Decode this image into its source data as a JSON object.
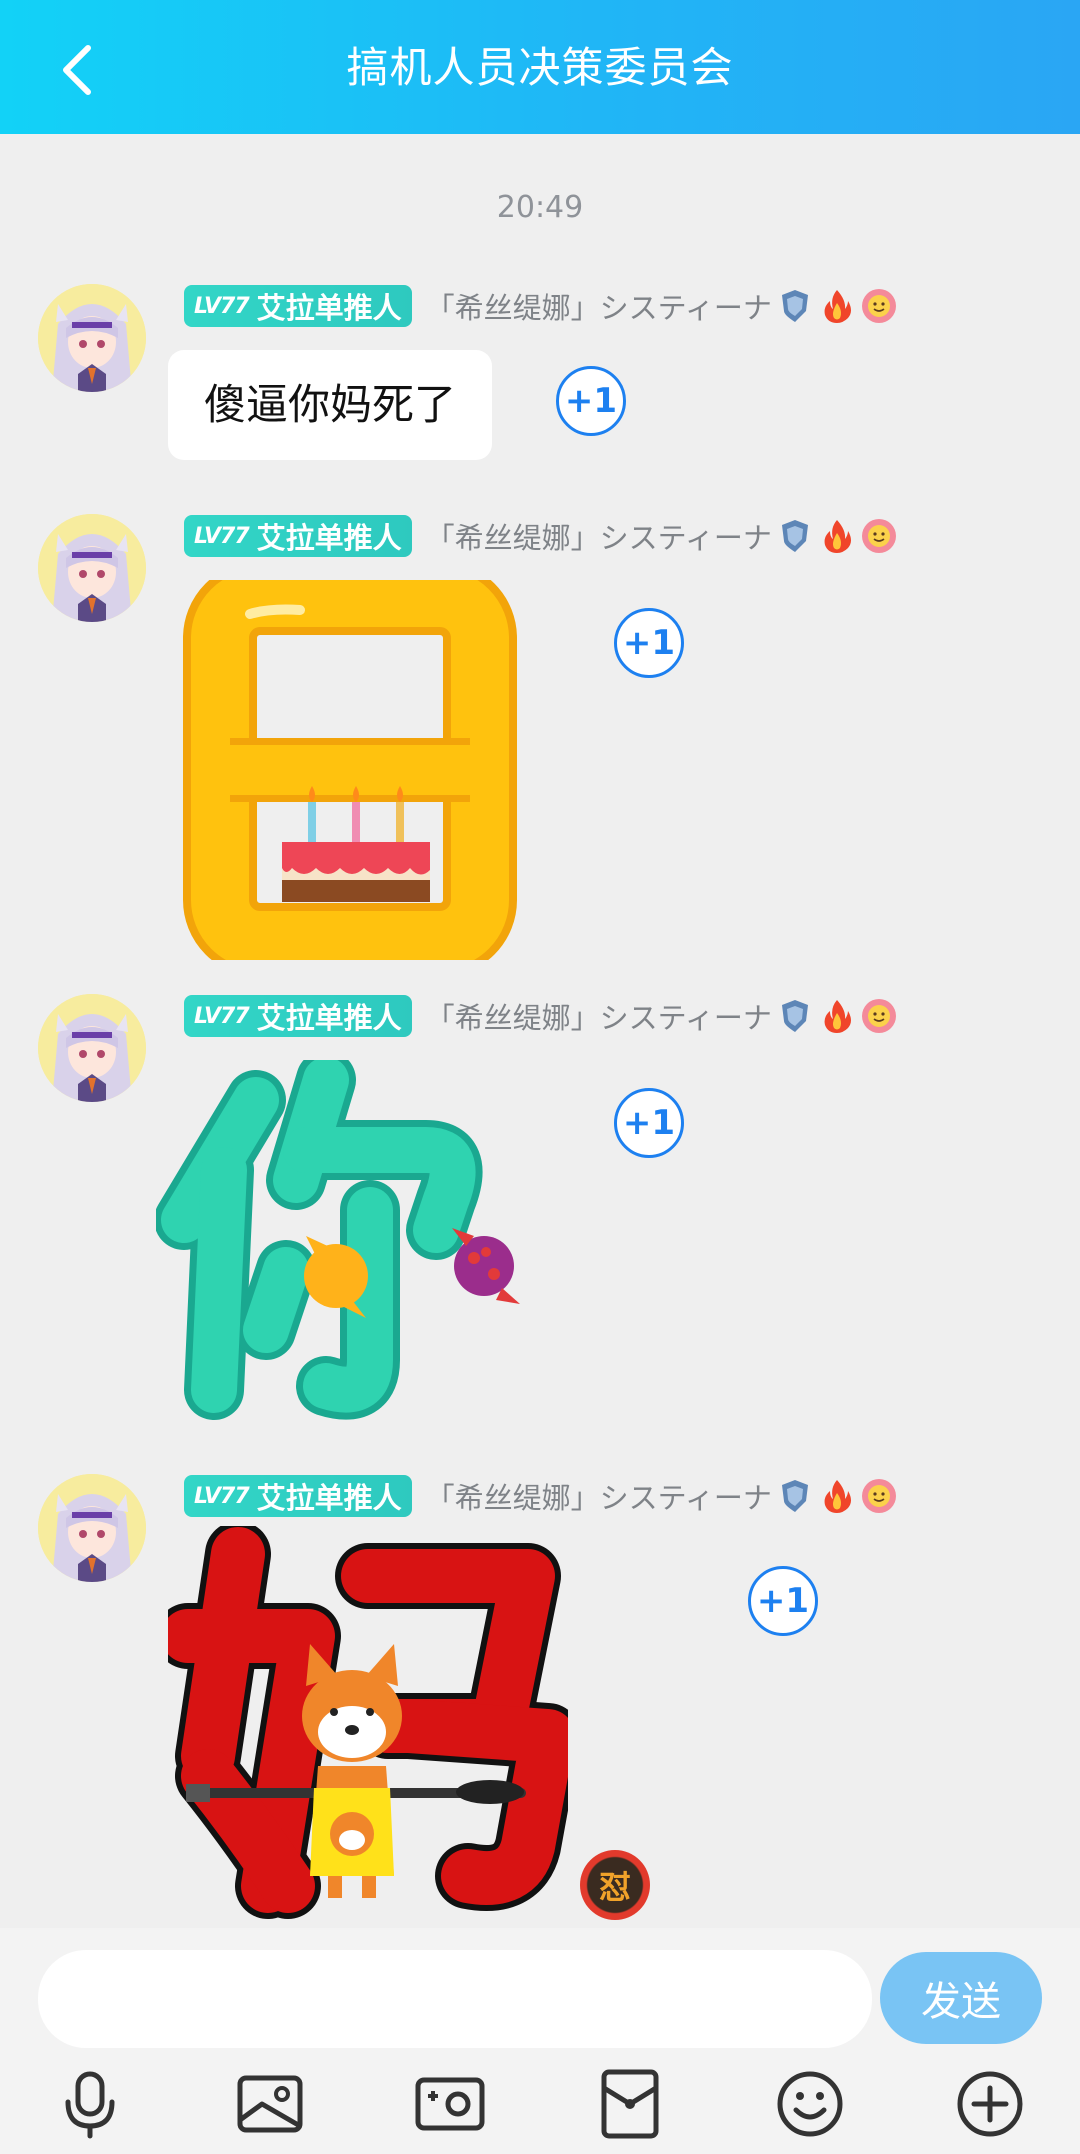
{
  "header": {
    "title": "搞机人员决策委员会"
  },
  "timestamp": "20:49",
  "sender": {
    "level": "LV77",
    "role": "艾拉单推人",
    "name": "「希丝缇娜」システィーナ"
  },
  "messages": [
    {
      "text": "傻逼你妈死了",
      "plus_one": "+1"
    },
    {
      "sticker_text": "日",
      "plus_one": "+1"
    },
    {
      "sticker_text": "你",
      "plus_one": "+1"
    },
    {
      "sticker_text": "妈",
      "plus_one": "+1",
      "reaction": "怼"
    }
  ],
  "input": {
    "value": "",
    "send_label": "发送"
  },
  "toolbar": [
    "microphone-icon",
    "image-icon",
    "camera-icon",
    "red-packet-icon",
    "emoji-icon",
    "plus-icon"
  ],
  "colors": {
    "header_start": "#12d2f7",
    "header_end": "#2aa6f4",
    "accent": "#1d80f0",
    "badge": "#32d6c7",
    "send": "#79c4f4"
  }
}
